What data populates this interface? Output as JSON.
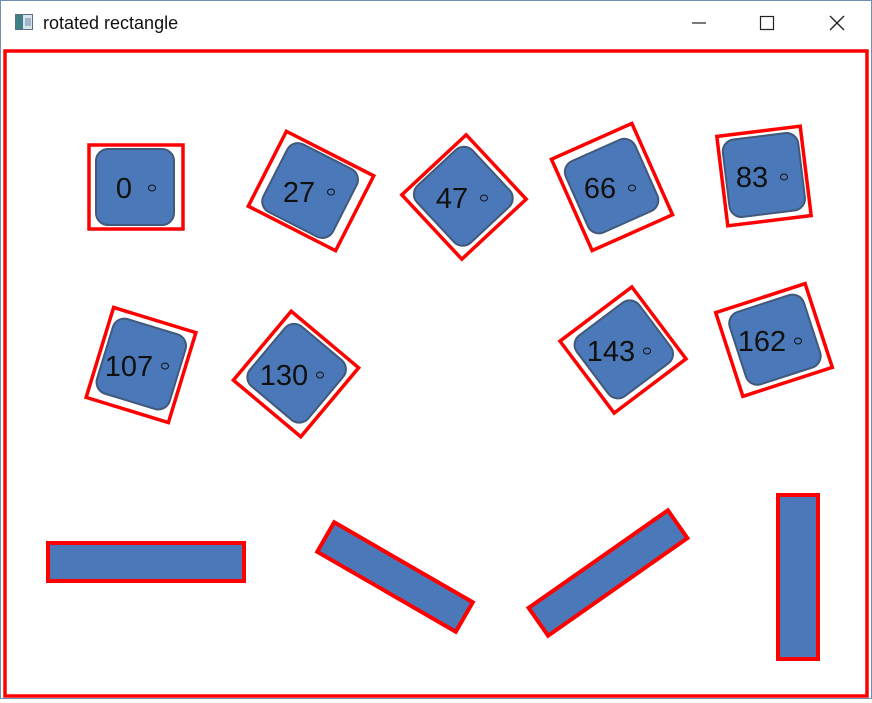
{
  "window": {
    "title": "rotated rectangle",
    "icon": "app-window-icon",
    "controls": [
      "minimize-icon",
      "maximize-icon",
      "close-icon"
    ]
  },
  "colors": {
    "fill": "#4a78b8",
    "fill_stroke": "#41597a",
    "outline": "#ff0000",
    "background": "#ffffff"
  },
  "labeled_shapes": [
    {
      "label": "0",
      "angle": 0
    },
    {
      "label": "27",
      "angle": 27
    },
    {
      "label": "47",
      "angle": 47
    },
    {
      "label": "66",
      "angle": 66
    },
    {
      "label": "83",
      "angle": 83
    },
    {
      "label": "107",
      "angle": 107
    },
    {
      "label": "130",
      "angle": 130
    },
    {
      "label": "143",
      "angle": 143
    },
    {
      "label": "162",
      "angle": 162
    }
  ],
  "bars": [
    {
      "angle": 0
    },
    {
      "angle": 30
    },
    {
      "angle": -35
    },
    {
      "angle": 90
    }
  ]
}
